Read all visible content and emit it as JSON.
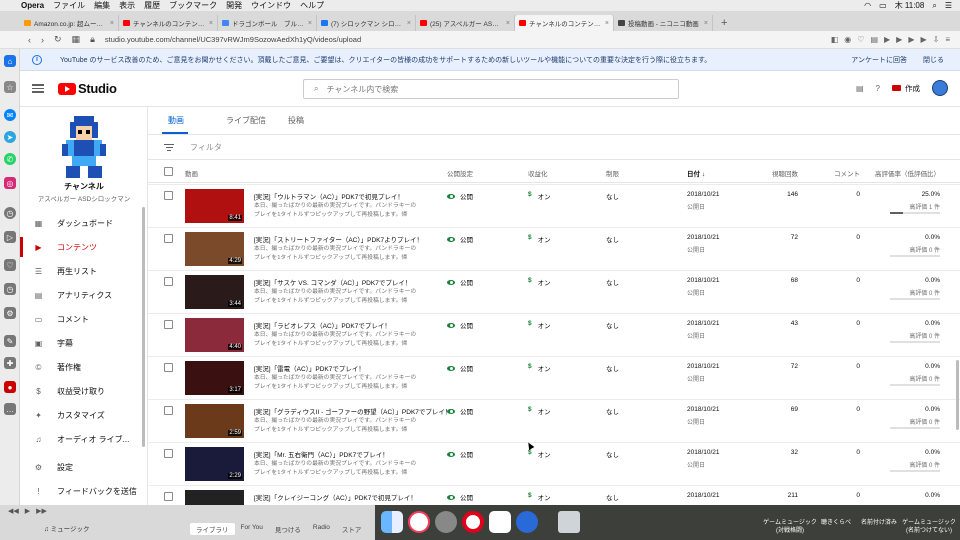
{
  "macos_menubar": {
    "app": "Opera",
    "items": [
      "ファイル",
      "編集",
      "表示",
      "履歴",
      "ブックマーク",
      "開発",
      "ウインドウ",
      "ヘルプ"
    ],
    "clock": "木 11:08"
  },
  "browser_tabs": [
    {
      "title": "Amazon.co.jp: 超ムーの世界R(",
      "color": "#ff9900"
    },
    {
      "title": "チャンネルのコンテンツ - YouT",
      "color": "#ff0000"
    },
    {
      "title": "ドラゴンボール　ブルマ　うきは",
      "color": "#4285f4"
    },
    {
      "title": "(7) シロックマン シロックマン",
      "color": "#1877f2"
    },
    {
      "title": "(25) アスペルガー ASDシロック",
      "color": "#ff0000"
    },
    {
      "title": "チャンネルのコンテンツ - YouT",
      "color": "#ff0000"
    },
    {
      "title": "投稿動画 - ニコニコ動画",
      "color": "#444444"
    }
  ],
  "active_tab": 5,
  "new_tab_label": "+",
  "address_bar": {
    "url": "studio.youtube.com/channel/UC397vRWJm9SozowAedXh1yQ/videos/upload"
  },
  "banner": {
    "text": "YouTube のサービス改善のため、ご意見をお聞かせください。頂戴したご意見、ご要望は、クリエイターの皆様の成功をサポートするための新しいツールや機能についての重要な決定を行う際に役立ちます。",
    "action_survey": "アンケートに回答",
    "action_close": "閉じる"
  },
  "yt_header": {
    "logo_text": "Studio",
    "search_placeholder": "チャンネル内で検索",
    "create_label": "作成"
  },
  "channel": {
    "title": "チャンネル",
    "subtitle": "アスペルガー ASDシロックマン"
  },
  "nav_items": [
    {
      "label": "ダッシュボード",
      "icon": "dashboard-icon",
      "glyph": "▦"
    },
    {
      "label": "コンテンツ",
      "icon": "content-icon",
      "glyph": "▶",
      "active": true
    },
    {
      "label": "再生リスト",
      "icon": "playlist-icon",
      "glyph": "☰"
    },
    {
      "label": "アナリティクス",
      "icon": "analytics-icon",
      "glyph": "▤"
    },
    {
      "label": "コメント",
      "icon": "comment-icon",
      "glyph": "▭"
    },
    {
      "label": "字幕",
      "icon": "subtitles-icon",
      "glyph": "▣"
    },
    {
      "label": "著作権",
      "icon": "copyright-icon",
      "glyph": "©"
    },
    {
      "label": "収益受け取り",
      "icon": "dollar-icon",
      "glyph": "$"
    },
    {
      "label": "カスタマイズ",
      "icon": "magic-wand-icon",
      "glyph": "✦"
    },
    {
      "label": "オーディオ ライブ...",
      "icon": "audio-library-icon",
      "glyph": "♫"
    },
    {
      "label": "設定",
      "icon": "gear-icon",
      "glyph": "⚙"
    },
    {
      "label": "フィードバックを送信",
      "icon": "feedback-icon",
      "glyph": "!"
    }
  ],
  "content_tabs": [
    {
      "label": "動画",
      "active": true
    },
    {
      "label": "ライブ配信"
    },
    {
      "label": "投稿"
    }
  ],
  "filter_placeholder": "フィルタ",
  "table_headers": {
    "video": "動画",
    "visibility": "公開設定",
    "monetization": "収益化",
    "restrictions": "制限",
    "date": "日付",
    "date_sort": "↓",
    "views": "視聴回数",
    "comments": "コメント",
    "rating": "高評価率（低評価比）"
  },
  "rows": [
    {
      "title": "[実況]「ウルトラマン（AC）」PDK7で初見プレイ！",
      "desc": "本日、撮ったばかりの最新の実況プレイです。パンドラキーの",
      "desc2": "プレイを1タイトルずつピックアップして再投稿します。帰",
      "duration": "8:41",
      "thumb": "#b01010",
      "visibility": "公開",
      "monetization": "オン",
      "restriction": "なし",
      "date": "2018/10/21",
      "date_sub": "公開日",
      "views": "146",
      "comments": "0",
      "rating": "25.0%",
      "rating_sub": "高評価 1 件",
      "bar": 0.25
    },
    {
      "title": "[実況]「ストリートファイター（AC）」PDK7よりプレイ！",
      "desc": "本日、撮ったばかりの最新の実況プレイです。パンドラキーの",
      "desc2": "プレイを1タイトルずつピックアップして再投稿します。帰",
      "duration": "4:29",
      "thumb": "#7a4a2a",
      "visibility": "公開",
      "monetization": "オン",
      "restriction": "なし",
      "date": "2018/10/21",
      "date_sub": "公開日",
      "views": "72",
      "comments": "0",
      "rating": "0.0%",
      "rating_sub": "高評価 0 件",
      "bar": 0
    },
    {
      "title": "[実況]「サスケ VS. コマンダ（AC）」PDK7でプレイ！",
      "desc": "本日、撮ったばかりの最新の実況プレイです。パンドラキーの",
      "desc2": "プレイを1タイトルずつピックアップして再投稿します。帰",
      "duration": "3:44",
      "thumb": "#2a1a1a",
      "visibility": "公開",
      "monetization": "オン",
      "restriction": "なし",
      "date": "2018/10/21",
      "date_sub": "公開日",
      "views": "68",
      "comments": "0",
      "rating": "0.0%",
      "rating_sub": "高評価 0 件",
      "bar": 0
    },
    {
      "title": "[実況]「ラビオレプス（AC）」PDK7でプレイ！",
      "desc": "本日、撮ったばかりの最新の実況プレイです。パンドラキーの",
      "desc2": "プレイを1タイトルずつピックアップして再投稿します。帰",
      "duration": "4:40",
      "thumb": "#8a2a3a",
      "visibility": "公開",
      "monetization": "オン",
      "restriction": "なし",
      "date": "2018/10/21",
      "date_sub": "公開日",
      "views": "43",
      "comments": "0",
      "rating": "0.0%",
      "rating_sub": "高評価 0 件",
      "bar": 0
    },
    {
      "title": "[実況]「雷電（AC）」PDK7でプレイ！",
      "desc": "本日、撮ったばかりの最新の実況プレイです。パンドラキーの",
      "desc2": "プレイを1タイトルずつピックアップして再投稿します。帰",
      "duration": "3:17",
      "thumb": "#3a1010",
      "visibility": "公開",
      "monetization": "オン",
      "restriction": "なし",
      "date": "2018/10/21",
      "date_sub": "公開日",
      "views": "72",
      "comments": "0",
      "rating": "0.0%",
      "rating_sub": "高評価 0 件",
      "bar": 0
    },
    {
      "title": "[実況]「グラディウスII - ゴーファーの野望（AC）」PDK7でプレイ！",
      "desc": "本日、撮ったばかりの最新の実況プレイです。パンドラキーの",
      "desc2": "プレイを1タイトルずつピックアップして再投稿します。帰",
      "duration": "2:59",
      "thumb": "#6a3a1a",
      "visibility": "公開",
      "monetization": "オン",
      "restriction": "なし",
      "date": "2018/10/21",
      "date_sub": "公開日",
      "views": "69",
      "comments": "0",
      "rating": "0.0%",
      "rating_sub": "高評価 0 件",
      "bar": 0
    },
    {
      "title": "[実況]「Mr. 五右衛門（AC）」PDK7でプレイ！",
      "desc": "本日、撮ったばかりの最新の実況プレイです。パンドラキーの",
      "desc2": "プレイを1タイトルずつピックアップして再投稿します。帰",
      "duration": "2:29",
      "thumb": "#1a1a3a",
      "visibility": "公開",
      "monetization": "オン",
      "restriction": "なし",
      "date": "2018/10/21",
      "date_sub": "公開日",
      "views": "32",
      "comments": "0",
      "rating": "0.0%",
      "rating_sub": "高評価 0 件",
      "bar": 0
    },
    {
      "title": "[実況]「クレイジーコング（AC）」PDK7で初見プレイ！",
      "desc": "",
      "desc2": "",
      "duration": "",
      "thumb": "#222222",
      "visibility": "公開",
      "monetization": "オン",
      "restriction": "なし",
      "date": "2018/10/21",
      "date_sub": "",
      "views": "211",
      "comments": "0",
      "rating": "0.0%",
      "rating_sub": "",
      "bar": 0
    }
  ],
  "dock": {
    "itunes_label": "♫ ミュージック",
    "itunes_tabs": [
      "ライブラリ",
      "For You",
      "見つける",
      "Radio",
      "ストア"
    ],
    "right_labels": [
      "ゲームミュージック\n(対戦格闘)",
      "聴きくらべ",
      "名前付け済み",
      "ゲームミュージック\n(名前つけてない)"
    ]
  },
  "colors": {
    "accent": "#065fd4",
    "brand": "#ff0000",
    "active_nav": "#cc0000",
    "visibility_green": "#188038"
  }
}
